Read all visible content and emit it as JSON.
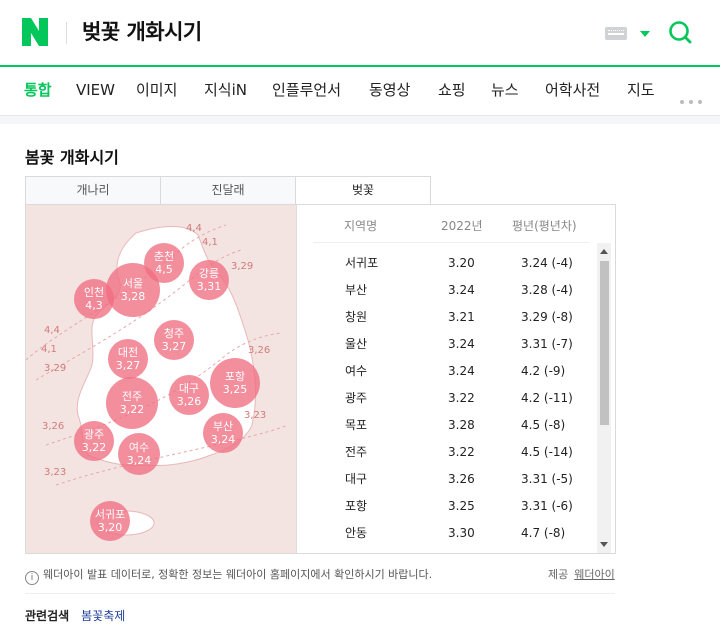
{
  "header": {
    "logo_letter": "N",
    "query": "벚꽃 개화시기",
    "brand_color": "#03c75a"
  },
  "nav_tabs": [
    "통합",
    "VIEW",
    "이미지",
    "지식iN",
    "인플루언서",
    "동영상",
    "쇼핑",
    "뉴스",
    "어학사전",
    "지도"
  ],
  "card": {
    "title": "봄꽃 개화시기",
    "subtabs": [
      "개나리",
      "진달래",
      "벚꽃"
    ],
    "active_subtab": "벚꽃"
  },
  "map": {
    "cities": [
      {
        "name": "춘천",
        "date": "4,5"
      },
      {
        "name": "강릉",
        "date": "3,31"
      },
      {
        "name": "인천",
        "date": "4,3"
      },
      {
        "name": "서울",
        "date": "3,28"
      },
      {
        "name": "청주",
        "date": "3,27"
      },
      {
        "name": "대전",
        "date": "3,27"
      },
      {
        "name": "포항",
        "date": "3,25"
      },
      {
        "name": "대구",
        "date": "3,26"
      },
      {
        "name": "전주",
        "date": "3,22"
      },
      {
        "name": "부산",
        "date": "3,24"
      },
      {
        "name": "광주",
        "date": "3,22"
      },
      {
        "name": "여수",
        "date": "3,24"
      },
      {
        "name": "서귀포",
        "date": "3,20"
      }
    ],
    "contour_labels": [
      "4,4",
      "4,1",
      "3,29",
      "4,4",
      "4,1",
      "3,29",
      "3,26",
      "3,26",
      "3,23",
      "3,23"
    ]
  },
  "table": {
    "headers": [
      "지역명",
      "2022년",
      "평년(평년차)"
    ],
    "rows": [
      [
        "서귀포",
        "3.20",
        "3.24 (-4)"
      ],
      [
        "부산",
        "3.24",
        "3.28 (-4)"
      ],
      [
        "창원",
        "3.21",
        "3.29 (-8)"
      ],
      [
        "울산",
        "3.24",
        "3.31 (-7)"
      ],
      [
        "여수",
        "3.24",
        "4.2 (-9)"
      ],
      [
        "광주",
        "3.22",
        "4.2 (-11)"
      ],
      [
        "목포",
        "3.28",
        "4.5 (-8)"
      ],
      [
        "전주",
        "3.22",
        "4.5 (-14)"
      ],
      [
        "대구",
        "3.26",
        "3.31 (-5)"
      ],
      [
        "포항",
        "3.25",
        "3.31 (-6)"
      ],
      [
        "안동",
        "3.30",
        "4.7 (-8)"
      ]
    ]
  },
  "footer": {
    "info_text": "웨더아이 발표 데이터로, 정확한 정보는 웨더아이 홈페이지에서 확인하시기 바랍니다.",
    "source_label": "제공",
    "source_link": "웨더아이",
    "related_label": "관련검색",
    "related_link": "봄꽃축제"
  }
}
